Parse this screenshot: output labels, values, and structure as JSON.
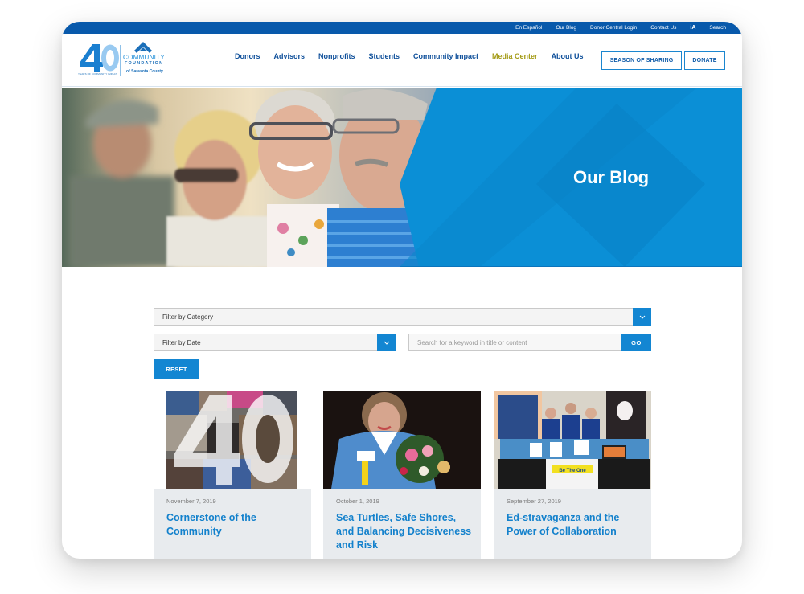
{
  "utility_nav": {
    "items": [
      "En Español",
      "Our Blog",
      "Donor Central Login",
      "Contact Us",
      "iA",
      "Search"
    ]
  },
  "logo": {
    "number": "40",
    "tagline": "YEARS OF COMMUNITY IMPACT",
    "line1": "COMMUNITY",
    "line2": "FOUNDATION",
    "line3": "of Sarasota County"
  },
  "main_nav": {
    "items": [
      {
        "label": "Donors",
        "active": false
      },
      {
        "label": "Advisors",
        "active": false
      },
      {
        "label": "Nonprofits",
        "active": false
      },
      {
        "label": "Students",
        "active": false
      },
      {
        "label": "Community Impact",
        "active": false
      },
      {
        "label": "Media Center",
        "active": true
      },
      {
        "label": "About Us",
        "active": false
      }
    ],
    "season_button": "SEASON OF SHARING",
    "donate_button": "DONATE"
  },
  "hero": {
    "title": "Our Blog"
  },
  "filters": {
    "category_select": "Filter by Category",
    "date_select": "Filter by Date",
    "search_placeholder": "Search for a keyword in title or content",
    "search_value": "",
    "go_button": "GO",
    "reset_button": "RESET"
  },
  "posts": [
    {
      "date": "November 7, 2019",
      "title": "Cornerstone of the Community",
      "image": "40th-anniversary-photo-collage"
    },
    {
      "date": "October 1, 2019",
      "title": "Sea Turtles, Safe Shores, and Balancing Decisiveness and Risk",
      "image": "woman-holding-flower-bouquet"
    },
    {
      "date": "September 27, 2019",
      "title": "Ed-stravaganza and the Power of Collaboration",
      "image": "booth-with-be-the-one-sign",
      "image_text": "Be The One"
    }
  ],
  "colors": {
    "brand_dark_blue": "#0859ab",
    "nav_blue": "#0e4f9a",
    "accent_blue": "#1386d2",
    "active_nav_olive": "#a39a14",
    "hero_blue": "#0b8fd6",
    "card_bg": "#e8ebee"
  }
}
